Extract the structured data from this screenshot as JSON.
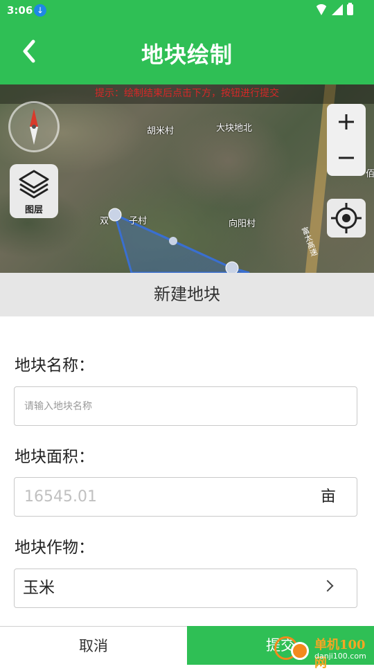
{
  "status_bar": {
    "time": "3:06"
  },
  "header": {
    "title": "地块绘制"
  },
  "map": {
    "hint": "提示：绘制结束后点击下方，按钮进行提交",
    "places": [
      "胡米村",
      "大块地北",
      "双",
      "子村",
      "向阳村",
      "佰"
    ],
    "road_label": "富太高速",
    "layers_label": "图层"
  },
  "sheet": {
    "title": "新建地块",
    "name_label": "地块名称：",
    "name_placeholder": "请输入地块名称",
    "area_label": "地块面积：",
    "area_placeholder": "16545.01",
    "area_unit": "亩",
    "crop_label": "地块作物：",
    "crop_value": "玉米"
  },
  "buttons": {
    "cancel": "取消",
    "submit": "提交"
  },
  "watermark": {
    "text": "单机100网",
    "url": "danji100.com"
  },
  "colors": {
    "brand_green": "#2fbf55",
    "hint_red": "#d62828",
    "polygon_blue": "#3a6fd0"
  }
}
